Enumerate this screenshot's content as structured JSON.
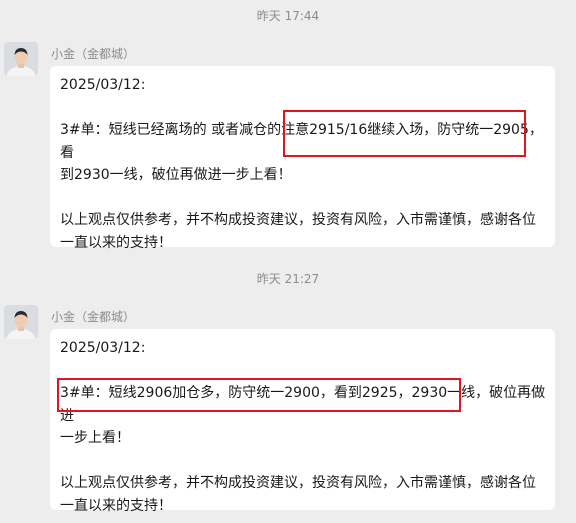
{
  "messages": [
    {
      "timestamp": "昨天 17:44",
      "sender": "小金（金都城）",
      "lines": {
        "date": "2025/03/12:",
        "body_1": "3#单：短线已经离场的 或者减仓的注意2915/16继续入场，防守统一2905，看",
        "body_2": "到2930一线，破位再做进一步上看！",
        "disclaimer_1": "以上观点仅供参考，并不构成投资建议，投资有风险，入市需谨慎，感谢各位",
        "disclaimer_2": "一直以来的支持！"
      }
    },
    {
      "timestamp": "昨天 21:27",
      "sender": "小金（金都城）",
      "lines": {
        "date": "2025/03/12:",
        "body_1": "3#单：短线2906加仓多，防守统一2900，看到2925，2930一线，破位再做进",
        "body_2": "一步上看！",
        "disclaimer_1": "以上观点仅供参考，并不构成投资建议，投资有风险，入市需谨慎，感谢各位",
        "disclaimer_2": "一直以来的支持！"
      }
    }
  ],
  "colors": {
    "background": "#ededed",
    "bubble": "#ffffff",
    "highlight": "#e0161f",
    "meta_text": "#8c8c8c"
  }
}
